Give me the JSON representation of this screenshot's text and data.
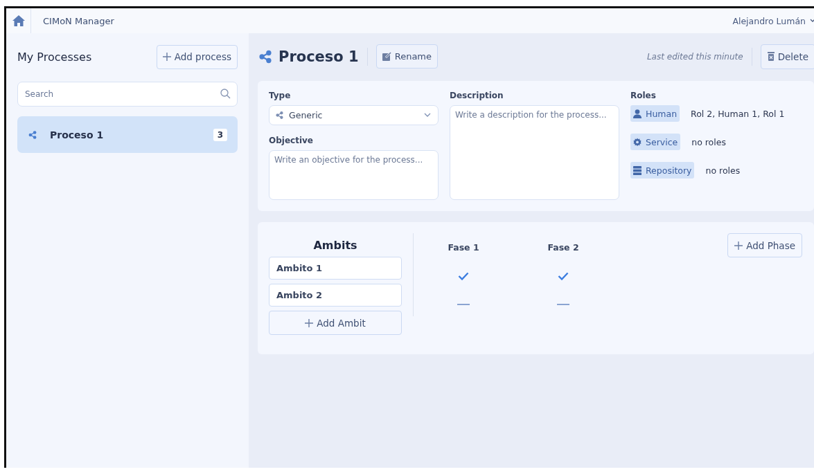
{
  "header": {
    "title": "CIMoN Manager",
    "user": "Alejandro Lumán"
  },
  "sidebar": {
    "title": "My Processes",
    "add_button": "Add process",
    "search": {
      "placeholder": "Search"
    },
    "items": [
      {
        "label": "Proceso 1",
        "count": "3",
        "selected": true
      }
    ]
  },
  "process": {
    "title": "Proceso 1",
    "rename_button": "Rename",
    "last_edited": "Last edited this minute",
    "delete_button": "Delete",
    "type": {
      "label": "Type",
      "value": "Generic"
    },
    "objective": {
      "label": "Objective",
      "placeholder": "Write an objective for the process..."
    },
    "description": {
      "label": "Description",
      "placeholder": "Write a description for the process..."
    },
    "roles": {
      "label": "Roles",
      "items": [
        {
          "kind": "human",
          "label": "Human",
          "value": "Rol 2, Human 1, Rol 1"
        },
        {
          "kind": "service",
          "label": "Service",
          "value": "no roles"
        },
        {
          "kind": "repository",
          "label": "Repository",
          "value": "no roles"
        }
      ]
    }
  },
  "matrix": {
    "title": "Ambits",
    "phases": [
      "Fase 1",
      "Fase 2"
    ],
    "add_phase": "Add Phase",
    "add_ambit": "Add Ambit",
    "ambits": [
      {
        "name": "Ambito 1",
        "cells": [
          {
            "on": true
          },
          {
            "on": true
          }
        ]
      },
      {
        "name": "Ambito 2",
        "cells": [
          {
            "on": false
          },
          {
            "on": false
          }
        ]
      }
    ]
  }
}
